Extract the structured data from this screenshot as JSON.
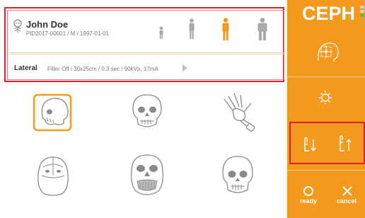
{
  "patient": {
    "name": "John Doe",
    "info": "PID2017-00001 / M / 1997-01-01",
    "sizes": [
      "child-figure-icon",
      "small-adult-figure-icon",
      "adult-figure-icon",
      "large-adult-figure-icon"
    ],
    "selected_size": "adult-figure-icon"
  },
  "exposure": {
    "mode": "Lateral",
    "params": "Filter Off / 30x25cm / 0.3 sec / 90kVp, 17mA"
  },
  "projections": [
    {
      "icon": "skull-lateral-icon",
      "selected": true
    },
    {
      "icon": "skull-frontal-icon",
      "selected": false
    },
    {
      "icon": "hand-xray-icon",
      "selected": false
    },
    {
      "icon": "skull-top-icon",
      "selected": false
    },
    {
      "icon": "skull-waters-icon",
      "selected": false
    },
    {
      "icon": "skull-pa-icon",
      "selected": false
    }
  ],
  "sidebar": {
    "title": "CEPH",
    "ready_label": "ready",
    "cancel_label": "cancel"
  },
  "colors": {
    "accent": "#f39a1e",
    "highlight": "#d9232f",
    "icon_gray": "#9e9e9e"
  }
}
